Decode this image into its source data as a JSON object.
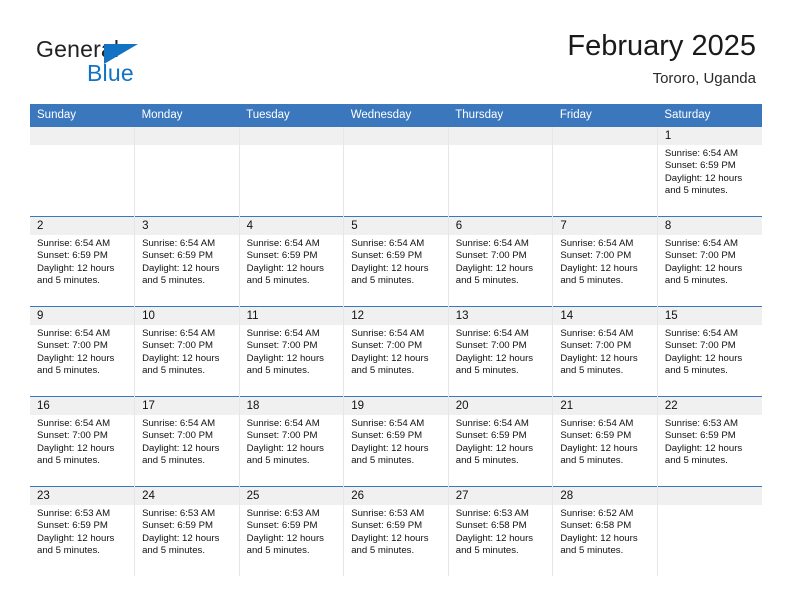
{
  "brand": {
    "word_one": "General",
    "word_two": "Blue",
    "triangle_color": "#1273c4",
    "triangle_icon": "triangle-logo-icon"
  },
  "header": {
    "title": "February 2025",
    "location": "Tororo, Uganda",
    "header_bg_color": "#3a77bd",
    "row_rule_color": "#3a77bd",
    "daynum_band_color": "#f0f0f0"
  },
  "weekday_headers": [
    "Sunday",
    "Monday",
    "Tuesday",
    "Wednesday",
    "Thursday",
    "Friday",
    "Saturday"
  ],
  "labels": {
    "sunrise_prefix": "Sunrise:",
    "sunset_prefix": "Sunset:",
    "daylight_prefix": "Daylight:"
  },
  "weeks": [
    [
      {
        "day": "",
        "empty": true
      },
      {
        "day": "",
        "empty": true
      },
      {
        "day": "",
        "empty": true
      },
      {
        "day": "",
        "empty": true
      },
      {
        "day": "",
        "empty": true
      },
      {
        "day": "",
        "empty": true
      },
      {
        "day": "1",
        "sunrise": "Sunrise: 6:54 AM",
        "sunset": "Sunset: 6:59 PM",
        "daylight": "Daylight: 12 hours and 5 minutes."
      }
    ],
    [
      {
        "day": "2",
        "sunrise": "Sunrise: 6:54 AM",
        "sunset": "Sunset: 6:59 PM",
        "daylight": "Daylight: 12 hours and 5 minutes."
      },
      {
        "day": "3",
        "sunrise": "Sunrise: 6:54 AM",
        "sunset": "Sunset: 6:59 PM",
        "daylight": "Daylight: 12 hours and 5 minutes."
      },
      {
        "day": "4",
        "sunrise": "Sunrise: 6:54 AM",
        "sunset": "Sunset: 6:59 PM",
        "daylight": "Daylight: 12 hours and 5 minutes."
      },
      {
        "day": "5",
        "sunrise": "Sunrise: 6:54 AM",
        "sunset": "Sunset: 6:59 PM",
        "daylight": "Daylight: 12 hours and 5 minutes."
      },
      {
        "day": "6",
        "sunrise": "Sunrise: 6:54 AM",
        "sunset": "Sunset: 7:00 PM",
        "daylight": "Daylight: 12 hours and 5 minutes."
      },
      {
        "day": "7",
        "sunrise": "Sunrise: 6:54 AM",
        "sunset": "Sunset: 7:00 PM",
        "daylight": "Daylight: 12 hours and 5 minutes."
      },
      {
        "day": "8",
        "sunrise": "Sunrise: 6:54 AM",
        "sunset": "Sunset: 7:00 PM",
        "daylight": "Daylight: 12 hours and 5 minutes."
      }
    ],
    [
      {
        "day": "9",
        "sunrise": "Sunrise: 6:54 AM",
        "sunset": "Sunset: 7:00 PM",
        "daylight": "Daylight: 12 hours and 5 minutes."
      },
      {
        "day": "10",
        "sunrise": "Sunrise: 6:54 AM",
        "sunset": "Sunset: 7:00 PM",
        "daylight": "Daylight: 12 hours and 5 minutes."
      },
      {
        "day": "11",
        "sunrise": "Sunrise: 6:54 AM",
        "sunset": "Sunset: 7:00 PM",
        "daylight": "Daylight: 12 hours and 5 minutes."
      },
      {
        "day": "12",
        "sunrise": "Sunrise: 6:54 AM",
        "sunset": "Sunset: 7:00 PM",
        "daylight": "Daylight: 12 hours and 5 minutes."
      },
      {
        "day": "13",
        "sunrise": "Sunrise: 6:54 AM",
        "sunset": "Sunset: 7:00 PM",
        "daylight": "Daylight: 12 hours and 5 minutes."
      },
      {
        "day": "14",
        "sunrise": "Sunrise: 6:54 AM",
        "sunset": "Sunset: 7:00 PM",
        "daylight": "Daylight: 12 hours and 5 minutes."
      },
      {
        "day": "15",
        "sunrise": "Sunrise: 6:54 AM",
        "sunset": "Sunset: 7:00 PM",
        "daylight": "Daylight: 12 hours and 5 minutes."
      }
    ],
    [
      {
        "day": "16",
        "sunrise": "Sunrise: 6:54 AM",
        "sunset": "Sunset: 7:00 PM",
        "daylight": "Daylight: 12 hours and 5 minutes."
      },
      {
        "day": "17",
        "sunrise": "Sunrise: 6:54 AM",
        "sunset": "Sunset: 7:00 PM",
        "daylight": "Daylight: 12 hours and 5 minutes."
      },
      {
        "day": "18",
        "sunrise": "Sunrise: 6:54 AM",
        "sunset": "Sunset: 7:00 PM",
        "daylight": "Daylight: 12 hours and 5 minutes."
      },
      {
        "day": "19",
        "sunrise": "Sunrise: 6:54 AM",
        "sunset": "Sunset: 6:59 PM",
        "daylight": "Daylight: 12 hours and 5 minutes."
      },
      {
        "day": "20",
        "sunrise": "Sunrise: 6:54 AM",
        "sunset": "Sunset: 6:59 PM",
        "daylight": "Daylight: 12 hours and 5 minutes."
      },
      {
        "day": "21",
        "sunrise": "Sunrise: 6:54 AM",
        "sunset": "Sunset: 6:59 PM",
        "daylight": "Daylight: 12 hours and 5 minutes."
      },
      {
        "day": "22",
        "sunrise": "Sunrise: 6:53 AM",
        "sunset": "Sunset: 6:59 PM",
        "daylight": "Daylight: 12 hours and 5 minutes."
      }
    ],
    [
      {
        "day": "23",
        "sunrise": "Sunrise: 6:53 AM",
        "sunset": "Sunset: 6:59 PM",
        "daylight": "Daylight: 12 hours and 5 minutes."
      },
      {
        "day": "24",
        "sunrise": "Sunrise: 6:53 AM",
        "sunset": "Sunset: 6:59 PM",
        "daylight": "Daylight: 12 hours and 5 minutes."
      },
      {
        "day": "25",
        "sunrise": "Sunrise: 6:53 AM",
        "sunset": "Sunset: 6:59 PM",
        "daylight": "Daylight: 12 hours and 5 minutes."
      },
      {
        "day": "26",
        "sunrise": "Sunrise: 6:53 AM",
        "sunset": "Sunset: 6:59 PM",
        "daylight": "Daylight: 12 hours and 5 minutes."
      },
      {
        "day": "27",
        "sunrise": "Sunrise: 6:53 AM",
        "sunset": "Sunset: 6:58 PM",
        "daylight": "Daylight: 12 hours and 5 minutes."
      },
      {
        "day": "28",
        "sunrise": "Sunrise: 6:52 AM",
        "sunset": "Sunset: 6:58 PM",
        "daylight": "Daylight: 12 hours and 5 minutes."
      },
      {
        "day": "",
        "empty": true
      }
    ]
  ]
}
